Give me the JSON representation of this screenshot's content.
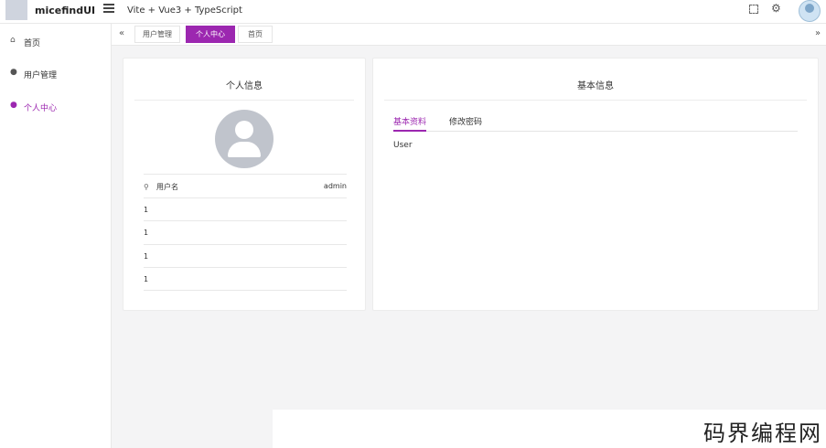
{
  "header": {
    "brand": "micefindUI",
    "title": "Vite + Vue3 + TypeScript"
  },
  "sidebar": {
    "items": [
      {
        "label": "首页",
        "icon": "home-icon"
      },
      {
        "label": "用户管理",
        "icon": "user-icon"
      },
      {
        "label": "个人中心",
        "icon": "user-icon",
        "active": true
      }
    ]
  },
  "tabs": {
    "items": [
      {
        "label": "用户管理"
      },
      {
        "label": "个人中心",
        "active": true
      },
      {
        "label": "首页"
      }
    ],
    "left_arrow": "«",
    "right_arrow": "»"
  },
  "profile": {
    "title": "个人信息",
    "rows": [
      {
        "key": "用户名",
        "value": "admin"
      },
      {
        "key": "1",
        "value": ""
      },
      {
        "key": "1",
        "value": ""
      },
      {
        "key": "1",
        "value": ""
      },
      {
        "key": "1",
        "value": ""
      }
    ]
  },
  "basic": {
    "title": "基本信息",
    "tabs": [
      "基本资料",
      "修改密码"
    ],
    "content": "User"
  },
  "watermark": "码界编程网",
  "colors": {
    "accent": "#9c27b0",
    "background": "#f4f4f5"
  }
}
